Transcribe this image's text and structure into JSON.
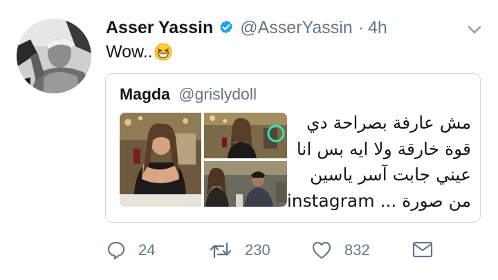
{
  "tweet": {
    "author_name": "Asser Yassin",
    "author_handle": "@AsserYassin",
    "separator": "·",
    "time": "4h",
    "text": "Wow..",
    "emoji": "grinning-squinting-face"
  },
  "quoted_tweet": {
    "author_name": "Magda",
    "author_handle": "@grislydoll",
    "text_lines": [
      "مش عارفة بصراحة دي",
      "قوة خارقة ولا ايه بس انا",
      "عيني جابت آسر ياسين",
      "من صورة ... instagram"
    ]
  },
  "actions": {
    "replies": "24",
    "retweets": "230",
    "likes": "832"
  },
  "colors": {
    "verified_blue": "#1da1f2",
    "secondary_text": "#657786",
    "border": "#ccd6dd",
    "highlight_circle": "#2ee8b6"
  }
}
